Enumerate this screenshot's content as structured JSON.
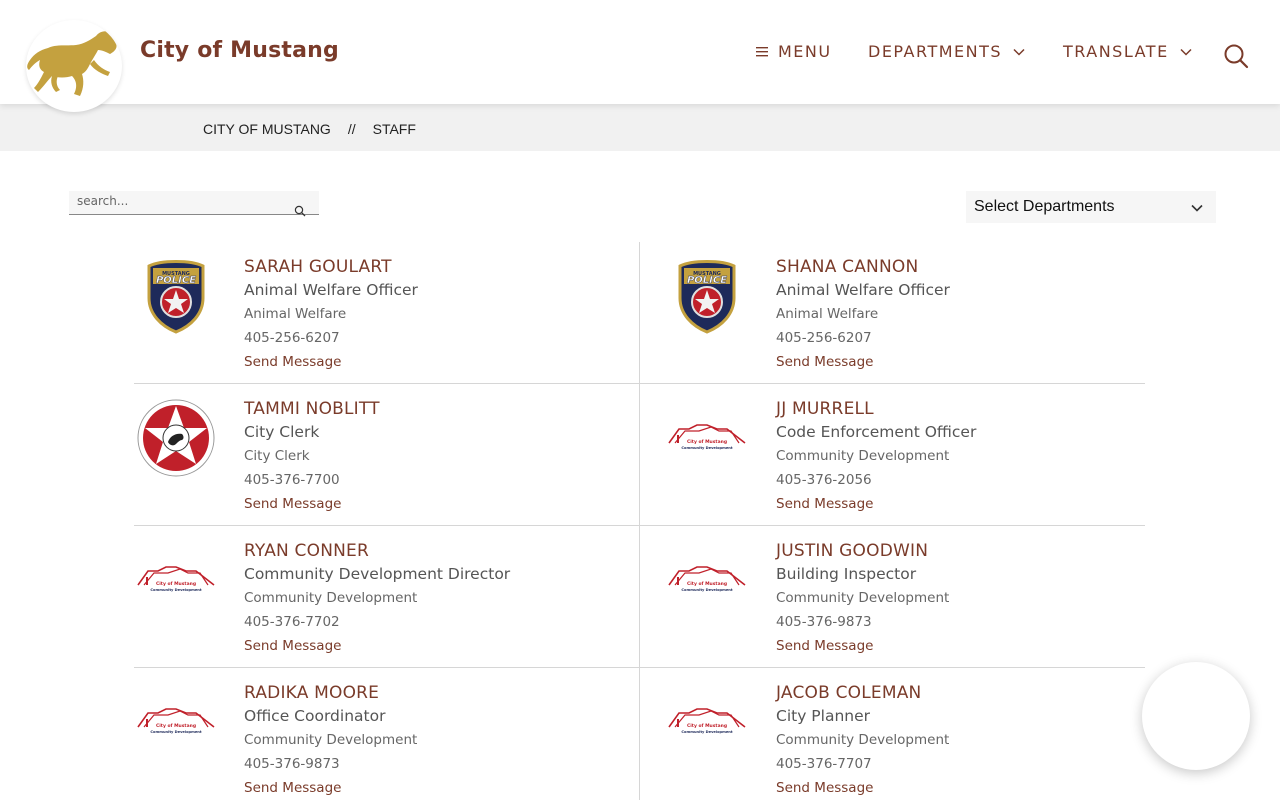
{
  "header": {
    "site_title": "City of Mustang",
    "logo_icon": "mustang-horse-logo",
    "nav": {
      "menu_label": "MENU",
      "departments_label": "DEPARTMENTS",
      "translate_label": "TRANSLATE"
    },
    "search_icon": "search-icon"
  },
  "breadcrumb": {
    "home": "CITY OF MUSTANG",
    "separator": "//",
    "current": "STAFF"
  },
  "controls": {
    "search_placeholder": "search...",
    "department_select": "Select Departments"
  },
  "staff": [
    {
      "name": "SARAH GOULART",
      "title": "Animal Welfare Officer",
      "department": "Animal Welfare",
      "phone": "405-256-6207",
      "action": "Send Message",
      "icon": "police-badge"
    },
    {
      "name": "SHANA CANNON",
      "title": "Animal Welfare Officer",
      "department": "Animal Welfare",
      "phone": "405-256-6207",
      "action": "Send Message",
      "icon": "police-badge"
    },
    {
      "name": "TAMMI NOBLITT",
      "title": "City Clerk",
      "department": "City Clerk",
      "phone": "405-376-7700",
      "action": "Send Message",
      "icon": "city-seal"
    },
    {
      "name": "JJ MURRELL",
      "title": "Code Enforcement Officer",
      "department": "Community Development",
      "phone": "405-376-2056",
      "action": "Send Message",
      "icon": "community-development-logo"
    },
    {
      "name": "RYAN CONNER",
      "title": "Community Development Director",
      "department": "Community Development",
      "phone": "405-376-7702",
      "action": "Send Message",
      "icon": "community-development-logo"
    },
    {
      "name": "JUSTIN GOODWIN",
      "title": "Building Inspector",
      "department": "Community Development",
      "phone": "405-376-9873",
      "action": "Send Message",
      "icon": "community-development-logo"
    },
    {
      "name": "RADIKA MOORE",
      "title": "Office Coordinator",
      "department": "Community Development",
      "phone": "405-376-9873",
      "action": "Send Message",
      "icon": "community-development-logo"
    },
    {
      "name": "JACOB COLEMAN",
      "title": "City Planner",
      "department": "Community Development",
      "phone": "405-376-7707",
      "action": "Send Message",
      "icon": "community-development-logo"
    }
  ],
  "logo_text": {
    "police_badge": [
      "MUSTANG",
      "POLICE"
    ],
    "community_development": [
      "City of Mustang",
      "Community Development"
    ]
  },
  "colors": {
    "brand_brown": "#7a3b2a",
    "logo_gold": "#c4a13f",
    "badge_navy": "#1e2a5a",
    "seal_red": "#c0202a"
  }
}
